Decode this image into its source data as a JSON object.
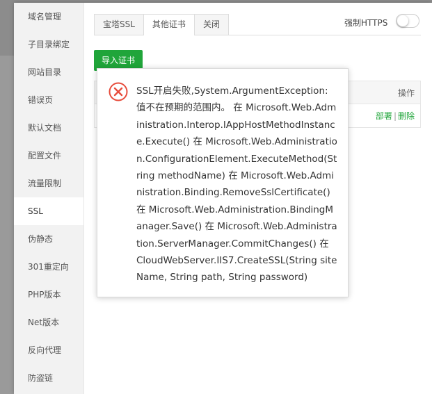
{
  "sidebar": {
    "items": [
      {
        "label": "域名管理"
      },
      {
        "label": "子目录绑定"
      },
      {
        "label": "网站目录"
      },
      {
        "label": "错误页"
      },
      {
        "label": "默认文档"
      },
      {
        "label": "配置文件"
      },
      {
        "label": "流量限制"
      },
      {
        "label": "SSL"
      },
      {
        "label": "伪静态"
      },
      {
        "label": "301重定向"
      },
      {
        "label": "PHP版本"
      },
      {
        "label": "Net版本"
      },
      {
        "label": "反向代理"
      },
      {
        "label": "防盗链"
      }
    ],
    "active_index": 7
  },
  "tabs": [
    {
      "label": "宝塔SSL"
    },
    {
      "label": "其他证书"
    },
    {
      "label": "关闭"
    }
  ],
  "active_tab": 1,
  "force_https": {
    "label": "强制HTTPS",
    "enabled": false
  },
  "import_button": {
    "label": "导入证书"
  },
  "table": {
    "header": {
      "actions": "操作"
    },
    "row": {
      "deploy": "部署",
      "separator": "|",
      "delete": "删除"
    }
  },
  "error_dialog": {
    "icon": "error-circle-x-icon",
    "icon_color": "#e74c3c",
    "message": "SSL开启失败,System.ArgumentException: 值不在预期的范围内。 在 Microsoft.Web.Administration.Interop.IAppHostMethodInstance.Execute() 在 Microsoft.Web.Administration.ConfigurationElement.ExecuteMethod(String methodName) 在 Microsoft.Web.Administration.Binding.RemoveSslCertificate() 在 Microsoft.Web.Administration.BindingManager.Save() 在 Microsoft.Web.Administration.ServerManager.CommitChanges() 在 CloudWebServer.IIS7.CreateSSL(String siteName, String path, String password)"
  },
  "colors": {
    "accent": "#20a53a",
    "error": "#e74c3c"
  }
}
